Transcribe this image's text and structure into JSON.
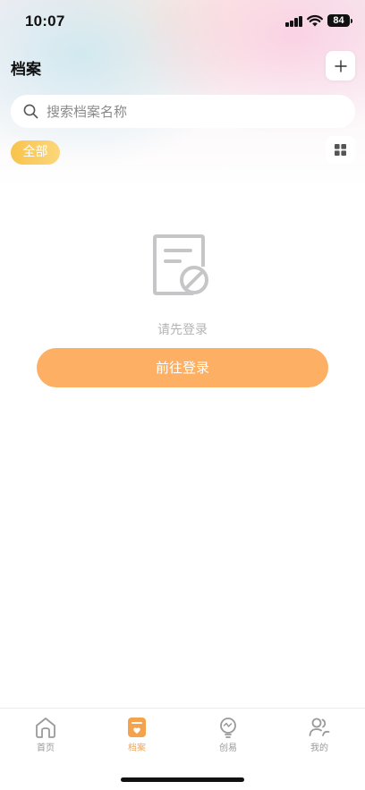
{
  "status_bar": {
    "time": "10:07",
    "battery": "84"
  },
  "header": {
    "title": "档案"
  },
  "search": {
    "placeholder": "搜索档案名称"
  },
  "filter": {
    "chip_label": "全部"
  },
  "empty_state": {
    "icon": "document-blocked-icon",
    "message": "请先登录",
    "button_label": "前往登录"
  },
  "tabbar": {
    "tabs": [
      {
        "label": "首页",
        "icon": "home-icon"
      },
      {
        "label": "档案",
        "icon": "archive-icon",
        "active": true
      },
      {
        "label": "创易",
        "icon": "bulb-icon"
      },
      {
        "label": "我的",
        "icon": "users-icon"
      }
    ]
  },
  "colors": {
    "accent_orange": "#fdb063",
    "chip_yellow": "#f9c34b",
    "tab_active": "#f3a650",
    "muted_text": "#b4b4b4"
  }
}
